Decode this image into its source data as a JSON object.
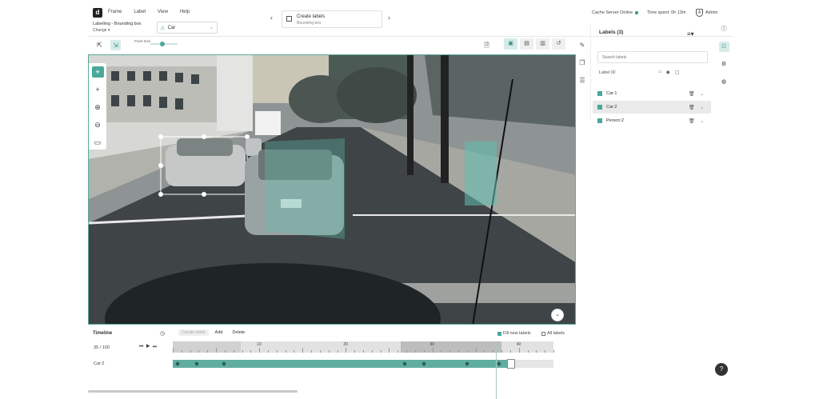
{
  "app": {
    "logo_letter": "d",
    "menu": [
      "Frame",
      "Label",
      "View",
      "Help"
    ],
    "subtitle": "Labelling - Bounding box",
    "change_link": "Change ▾",
    "class_selector": "Car",
    "task_title": "Create labels",
    "task_subtitle": "Bounding box",
    "server_status": "Cache Server Online",
    "time_spent": "Time spent: 0h 13m",
    "user": "Admin"
  },
  "toolbar": {
    "point_size_label": "Point Size",
    "point_size_value": 0.4
  },
  "labels_panel": {
    "title": "Labels (3)",
    "search_placeholder": "Search labels",
    "column_label": "Label ID",
    "items": [
      {
        "name": "Car:1",
        "color": "#4aa89a",
        "selected": false
      },
      {
        "name": "Car:2",
        "color": "#4aa89a",
        "selected": true
      },
      {
        "name": "Person:2",
        "color": "#4aa89a",
        "selected": false
      }
    ]
  },
  "timeline": {
    "title": "Timeline",
    "create_label": "Create label",
    "add_label": "Add",
    "delete_label": "Delete",
    "fill_new_labels": "Fill new labels",
    "all_labels": "All labels",
    "frame_counter": "35 / 100",
    "ticks": [
      "10",
      "20",
      "30",
      "40"
    ],
    "track_name": "Car:2",
    "track_progress": 0.88,
    "current_frame": 35,
    "total_frames": 100
  }
}
